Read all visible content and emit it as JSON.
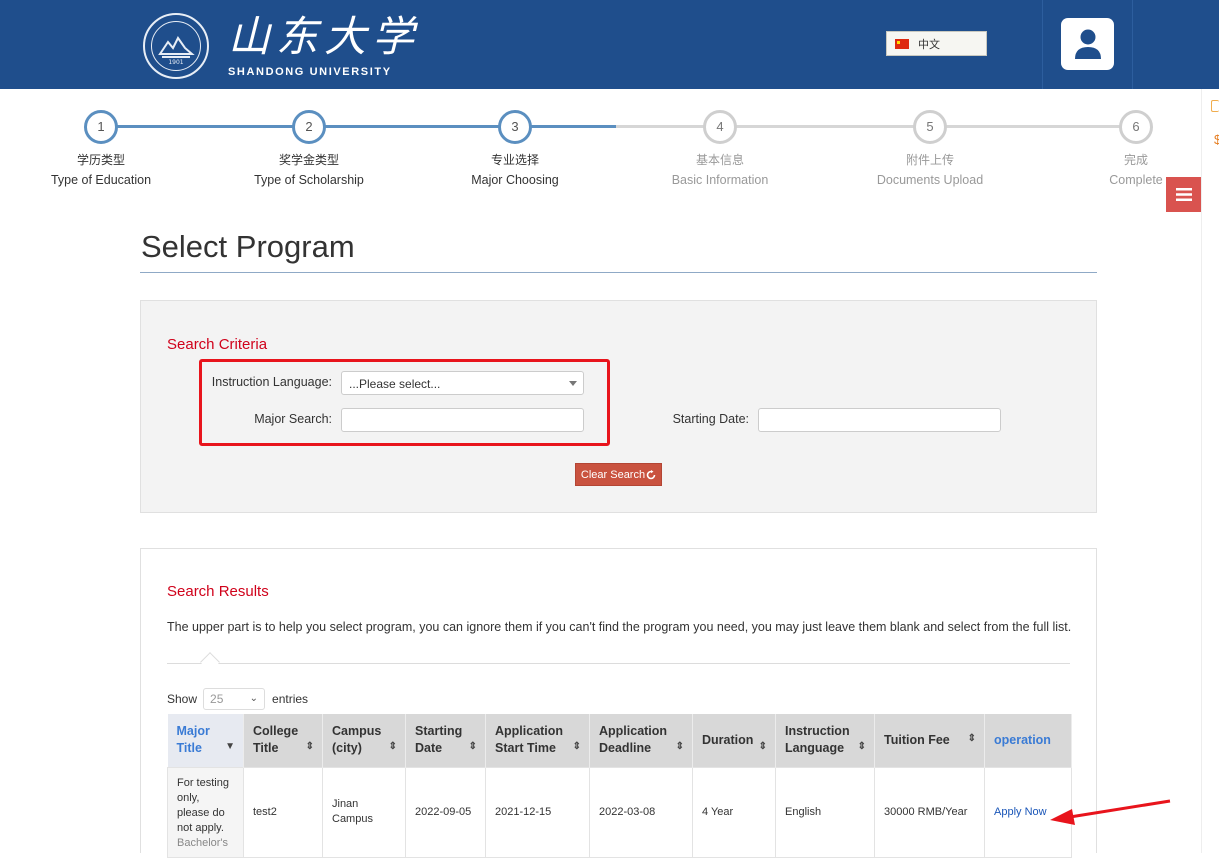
{
  "header": {
    "logo_cn": "山东大学",
    "logo_en": "SHANDONG UNIVERSITY",
    "seal_year": "1901",
    "language": "中文",
    "user_icon": "user-icon"
  },
  "steps": [
    {
      "num": "1",
      "cn": "学历类型",
      "en": "Type of Education",
      "active": true
    },
    {
      "num": "2",
      "cn": "奖学金类型",
      "en": "Type of Scholarship",
      "active": true
    },
    {
      "num": "3",
      "cn": "专业选择",
      "en": "Major Choosing",
      "active": true
    },
    {
      "num": "4",
      "cn": "基本信息",
      "en": "Basic Information",
      "active": false
    },
    {
      "num": "5",
      "cn": "附件上传",
      "en": "Documents Upload",
      "active": false
    },
    {
      "num": "6",
      "cn": "完成",
      "en": "Complete",
      "active": false
    }
  ],
  "page_title": "Select Program",
  "criteria": {
    "title": "Search Criteria",
    "instruction_language_label": "Instruction Language:",
    "instruction_language_value": "...Please select...",
    "major_search_label": "Major Search:",
    "major_search_value": "",
    "starting_date_label": "Starting Date:",
    "starting_date_value": "",
    "clear_button": "Clear Search",
    "clear_icon": "refresh-icon"
  },
  "results": {
    "title": "Search Results",
    "hint": "The upper part is to help you select program, you can ignore them if you can't find the program you need, you may just leave them blank and select from the full list.",
    "show_label": "Show",
    "entries_value": "25",
    "entries_label": "entries",
    "columns": [
      "Major Title",
      "College Title",
      "Campus (city)",
      "Starting Date",
      "Application Start Time",
      "Application Deadline",
      "Duration",
      "Instruction Language",
      "Tuition Fee",
      "operation"
    ],
    "rows": [
      {
        "major_title": "For testing only, please do not apply.",
        "major_sub": "Bachelor's",
        "college": "test2",
        "campus": "Jinan Campus",
        "starting_date": "2022-09-05",
        "app_start": "2021-12-15",
        "app_deadline": "2022-03-08",
        "duration": "4 Year",
        "language": "English",
        "tuition": "30000 RMB/Year",
        "operation": "Apply Now"
      }
    ]
  },
  "colors": {
    "header_bg": "#1f4e8c",
    "step_active": "#5b8fc0",
    "accent_red": "#d0021b",
    "clear_button": "#c9523f",
    "menu_button": "#d9534f"
  }
}
